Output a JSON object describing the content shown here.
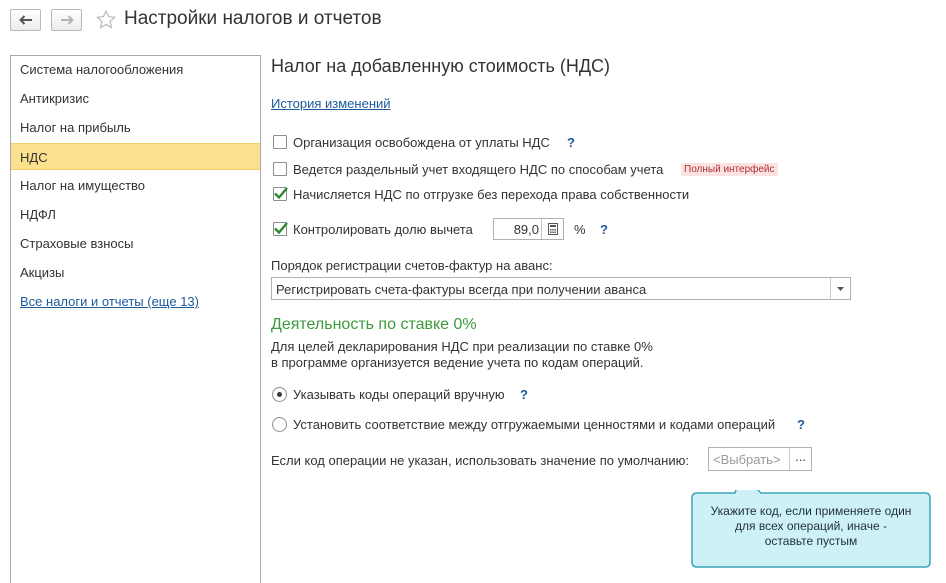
{
  "window": {
    "title": "Настройки налогов и отчетов"
  },
  "sidebar": {
    "items": [
      {
        "label": "Система налогообложения"
      },
      {
        "label": "Антикризис"
      },
      {
        "label": "Налог на прибыль"
      },
      {
        "label": "НДС"
      },
      {
        "label": "Налог на имущество"
      },
      {
        "label": "НДФЛ"
      },
      {
        "label": "Страховые взносы"
      },
      {
        "label": "Акцизы"
      },
      {
        "label": "Все налоги и отчеты (еще 13)"
      }
    ],
    "active_index": 3
  },
  "main": {
    "title": "Налог на добавленную стоимость (НДС)",
    "history_link": "История изменений",
    "checkboxes": [
      {
        "label": "Организация освобождена от уплаты НДС",
        "checked": false
      },
      {
        "label": "Ведется раздельный учет входящего НДС по способам учета",
        "checked": false,
        "badge": "Полный интерфейс"
      },
      {
        "label": "Начисляется НДС по отгрузке без перехода права собственности",
        "checked": true
      },
      {
        "label": "Контролировать долю вычета",
        "checked": true
      }
    ],
    "deduction_share": {
      "value": "89,0",
      "unit": "%"
    },
    "help_glyph": "?",
    "invoice_order": {
      "label": "Порядок регистрации счетов-фактур на аванс:",
      "selected": "Регистрировать счета-фактуры всегда при получении аванса"
    },
    "zero_rate": {
      "title": "Деятельность по ставке 0%",
      "description_line1": "Для целей декларирования НДС при реализации по ставке 0%",
      "description_line2": "в программе организуется ведение учета по кодам операций.",
      "radios": [
        {
          "label": "Указывать коды операций вручную",
          "selected": true
        },
        {
          "label": "Установить соответствие между отгружаемыми ценностями и кодами операций",
          "selected": false
        }
      ],
      "default_code": {
        "label": "Если код операции не указан, использовать значение по умолчанию:",
        "placeholder": "<Выбрать>",
        "button": "..."
      }
    }
  },
  "callout": {
    "line1": "Укажите код, если применяете один",
    "line2": "для всех операций,  иначе -",
    "line3": "оставьте пустым"
  },
  "colors": {
    "active_item": "#fbe08e",
    "link": "#1c5a9a",
    "section_green": "#3c9a3c",
    "callout_fill": "#cdf1f6",
    "callout_border": "#3aa6b8"
  },
  "icons": {
    "back": "arrow-left-icon",
    "forward": "arrow-right-icon",
    "favorite": "star-icon",
    "calculator": "calculator-icon",
    "dropdown": "chevron-down-icon",
    "checkmark": "check-icon"
  }
}
